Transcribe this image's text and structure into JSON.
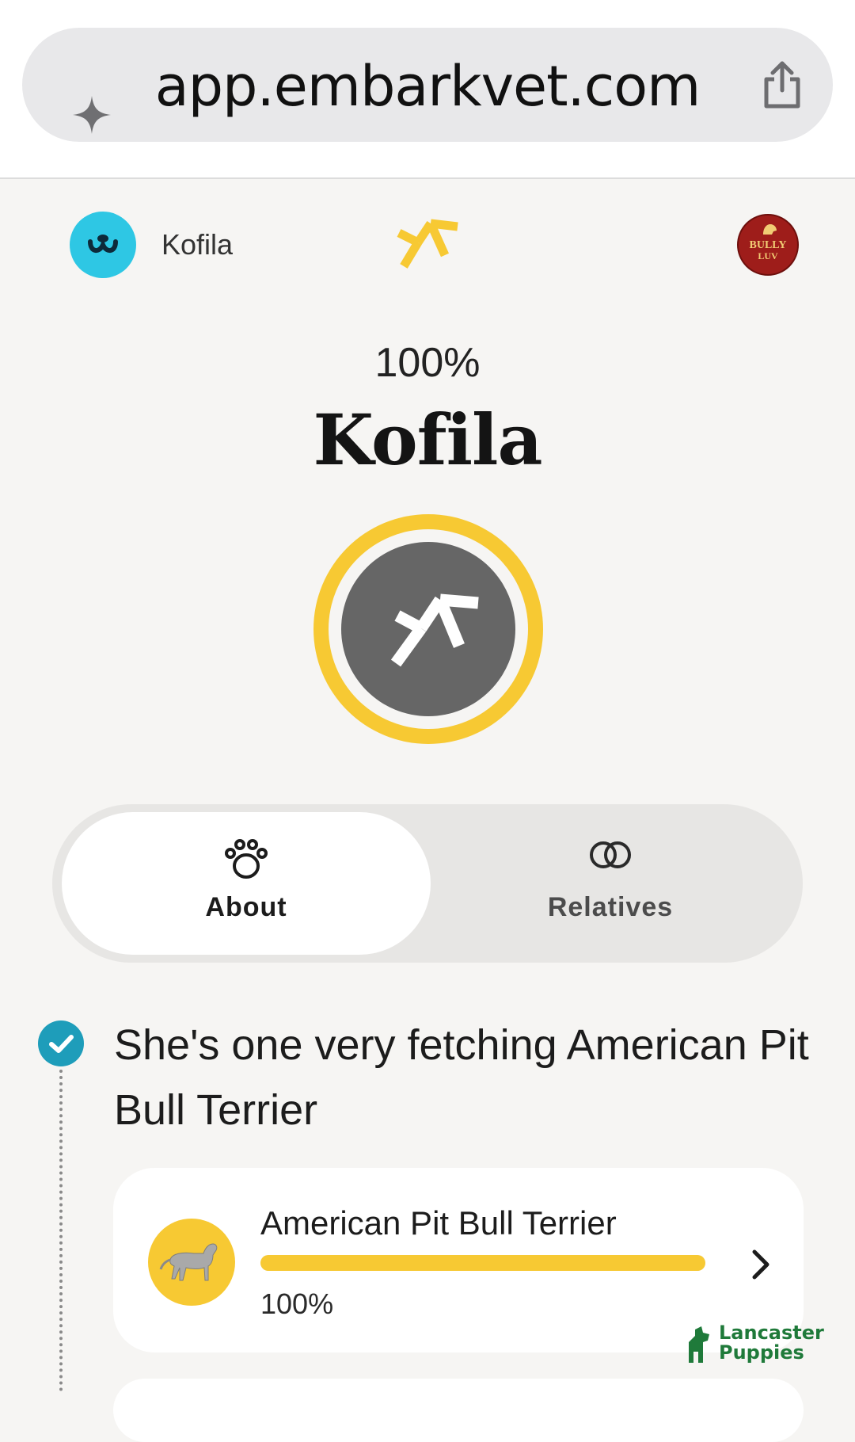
{
  "browser": {
    "url": "app.embarkvet.com"
  },
  "header": {
    "dog_name": "Kofila",
    "partner_logo_line1": "BULLY",
    "partner_logo_line2": "LUV"
  },
  "hero": {
    "percent": "100%",
    "title": "Kofila"
  },
  "tabs": [
    {
      "label": "About",
      "selected": true,
      "icon": "paw-icon"
    },
    {
      "label": "Relatives",
      "selected": false,
      "icon": "rings-icon"
    }
  ],
  "headline": "She's one very fetching American Pit Bull Terrier",
  "breeds": [
    {
      "name": "American Pit Bull Terrier",
      "percent_label": "100%",
      "fraction": 1.0
    }
  ],
  "watermark": {
    "line1": "Lancaster",
    "line2": "Puppies"
  },
  "colors": {
    "accent_yellow": "#f7c933",
    "avatar_teal": "#2ec7e4",
    "check_teal": "#1e9dba",
    "ring_inner_gray": "#666666",
    "partner_red": "#9e1d1a"
  }
}
